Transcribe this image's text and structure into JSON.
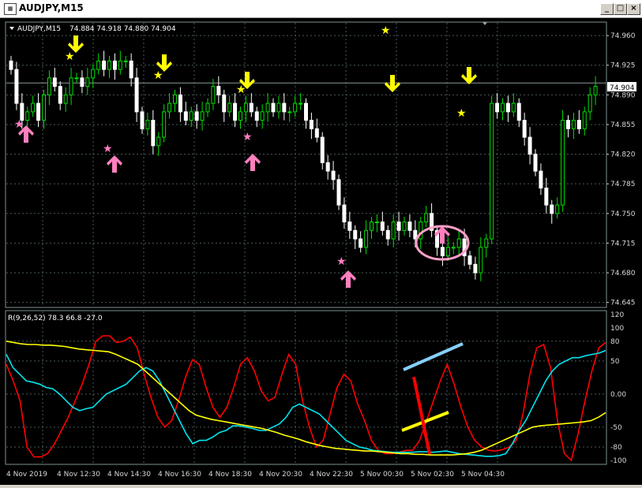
{
  "window": {
    "title": "AUDJPY,M15",
    "icon": "chart-window-icon",
    "buttons": {
      "minimize": "_",
      "restore": "□",
      "close": "×"
    }
  },
  "chart_data": [
    {
      "type": "candlestick",
      "title": "AUDJPY,M15",
      "ohlc_label": "74.884 74.918 74.880 74.904",
      "current_price": "74.904",
      "ylim": [
        74.64,
        74.975
      ],
      "y_ticks": [
        "74.960",
        "74.925",
        "74.890",
        "74.855",
        "74.820",
        "74.785",
        "74.750",
        "74.715",
        "74.680",
        "74.645"
      ],
      "x_labels": [
        "4 Nov 2019",
        "4 Nov 12:30",
        "4 Nov 14:30",
        "4 Nov 16:30",
        "4 Nov 18:30",
        "4 Nov 20:30",
        "4 Nov 22:30",
        "5 Nov 00:30",
        "5 Nov 02:30",
        "5 Nov 04:30"
      ],
      "grid": true,
      "colors": {
        "bull": "#00e000",
        "bear": "#ffffff",
        "background": "#000000",
        "grid": "#4a5a5a"
      },
      "closes": [
        74.92,
        74.88,
        74.86,
        74.87,
        74.88,
        74.86,
        74.89,
        74.91,
        74.9,
        74.88,
        74.89,
        74.91,
        74.91,
        74.9,
        74.91,
        74.92,
        74.93,
        74.92,
        74.93,
        74.92,
        74.93,
        74.93,
        74.91,
        74.87,
        74.85,
        74.86,
        74.83,
        74.84,
        74.87,
        74.88,
        74.89,
        74.87,
        74.86,
        74.87,
        74.86,
        74.87,
        74.88,
        74.9,
        74.89,
        74.87,
        74.88,
        74.86,
        74.87,
        74.88,
        74.87,
        74.86,
        74.87,
        74.88,
        74.87,
        74.88,
        74.87,
        74.87,
        74.88,
        74.88,
        74.86,
        74.85,
        74.84,
        74.81,
        74.8,
        74.79,
        74.76,
        74.74,
        74.73,
        74.72,
        74.71,
        74.73,
        74.74,
        74.74,
        74.73,
        74.72,
        74.74,
        74.73,
        74.74,
        74.73,
        74.72,
        74.74,
        74.75,
        74.73,
        74.71,
        74.7,
        74.71,
        74.71,
        74.72,
        74.7,
        74.69,
        74.68,
        74.71,
        74.72,
        74.88,
        74.87,
        74.88,
        74.87,
        74.88,
        74.86,
        74.84,
        74.82,
        74.8,
        74.78,
        74.76,
        74.75,
        74.76,
        74.86,
        74.85,
        74.86,
        74.85,
        74.87,
        74.89,
        74.9
      ],
      "rsi_panel": {
        "label": "R(9,26,52) 78.3 66.8 -27.0",
        "ylim": [
          -105,
          125
        ],
        "y_ticks": [
          "120",
          "100",
          "80",
          "50",
          "0.00",
          "-50",
          "-80",
          "-100"
        ],
        "series": [
          {
            "color": "#ff0000",
            "values": [
              45,
              20,
              -10,
              -80,
              -95,
              -95,
              -90,
              -75,
              -55,
              -35,
              -10,
              15,
              45,
              80,
              88,
              88,
              78,
              80,
              86,
              70,
              30,
              -5,
              -35,
              -50,
              -40,
              -10,
              25,
              52,
              45,
              10,
              -20,
              -35,
              -20,
              10,
              45,
              55,
              35,
              5,
              -10,
              -5,
              30,
              60,
              45,
              -10,
              -50,
              -80,
              -70,
              -30,
              10,
              30,
              20,
              -15,
              -40,
              -70,
              -85,
              -90,
              -90,
              -88,
              -85,
              -85,
              -70,
              -40,
              -10,
              20,
              45,
              15,
              -20,
              -50,
              -70,
              -80,
              -85,
              -86,
              -84,
              -80,
              -70,
              -30,
              30,
              70,
              75,
              40,
              -40,
              -90,
              -100,
              -60,
              -10,
              35,
              70,
              78
            ]
          },
          {
            "color": "#00e5ee",
            "values": [
              60,
              40,
              30,
              20,
              18,
              15,
              10,
              8,
              0,
              -10,
              -20,
              -25,
              -22,
              -20,
              -10,
              0,
              5,
              10,
              15,
              25,
              35,
              40,
              35,
              20,
              0,
              -20,
              -40,
              -60,
              -75,
              -70,
              -70,
              -65,
              -58,
              -55,
              -48,
              -48,
              -50,
              -52,
              -55,
              -55,
              -50,
              -45,
              -35,
              -20,
              -15,
              -20,
              -25,
              -30,
              -40,
              -50,
              -60,
              -70,
              -75,
              -80,
              -82,
              -85,
              -86,
              -87,
              -88,
              -88,
              -88,
              -88,
              -87,
              -87,
              -88,
              -87,
              -86,
              -88,
              -90,
              -91,
              -92,
              -93,
              -94,
              -94,
              -93,
              -90,
              -75,
              -55,
              -40,
              -20,
              0,
              20,
              35,
              45,
              50,
              55,
              55,
              58,
              60,
              62,
              66
            ]
          },
          {
            "color": "#ffff00",
            "values": [
              80,
              78,
              76,
              75,
              75,
              74,
              74,
              73,
              72,
              70,
              68,
              67,
              66,
              65,
              64,
              60,
              55,
              50,
              45,
              35,
              25,
              15,
              5,
              -5,
              -15,
              -25,
              -32,
              -35,
              -38,
              -40,
              -42,
              -44,
              -46,
              -48,
              -50,
              -52,
              -55,
              -58,
              -62,
              -65,
              -68,
              -72,
              -75,
              -78,
              -80,
              -82,
              -83,
              -84,
              -85,
              -86,
              -86,
              -87,
              -88,
              -89,
              -90,
              -90,
              -91,
              -91,
              -92,
              -92,
              -92,
              -92,
              -91,
              -90,
              -88,
              -85,
              -80,
              -75,
              -70,
              -65,
              -60,
              -55,
              -50,
              -48,
              -47,
              -46,
              -45,
              -44,
              -43,
              -42,
              -40,
              -35,
              -28
            ]
          }
        ]
      },
      "annotations": {
        "down_arrow_color": "#ffff00",
        "up_arrow_color": "#ff7fbf",
        "circle_color": "#ff9fc8"
      }
    }
  ]
}
